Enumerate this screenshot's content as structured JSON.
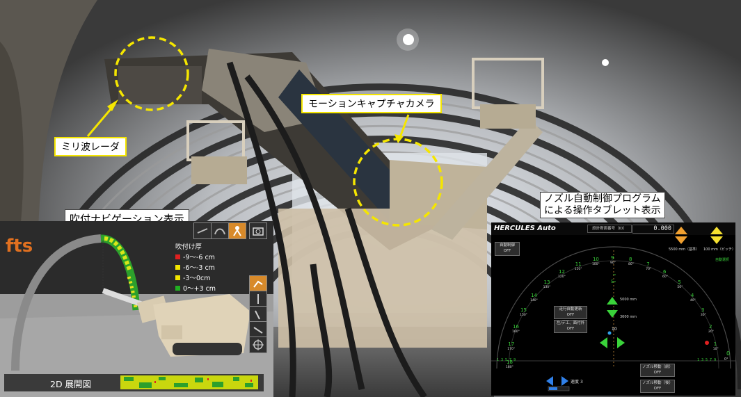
{
  "labels": {
    "radar": "ミリ波レーダ",
    "mocap": "モーションキャプチャカメラ",
    "nav_title": "吹付ナビゲーション表示",
    "tablet_title_line1": "ノズル自動制御プログラム",
    "tablet_title_line2": "による操作タブレット表示"
  },
  "nav": {
    "logo": "fts",
    "legend_title": "吹付け厚",
    "legend": [
      {
        "label": "-9〜-6 cm",
        "color": "#e02020"
      },
      {
        "label": "-6〜-3 cm",
        "color": "#f2e600"
      },
      {
        "label": "-3〜0cm",
        "color": "#f2e600"
      },
      {
        "label": "0〜+3 cm",
        "color": "#22b022"
      }
    ],
    "bottom_label": "2D 展開図",
    "tools": [
      "view-icon-1",
      "view-icon-2",
      "person-icon",
      "camera-icon"
    ],
    "side_tools": [
      "spray-icon",
      "nozzle-icon-1",
      "nozzle-icon-2",
      "nozzle-icon-3",
      "target-icon"
    ]
  },
  "tablet": {
    "brand": "HERCULES  Auto",
    "field_label": "設計断面番号（ID）",
    "field_value": "0.000",
    "auto_btn": "自動制御",
    "auto_btn_state": "OFF",
    "arrow_left_label": "5500 mm（基準）",
    "arrow_right_label": "100 mm（ピッチ）",
    "right_status": "自動選択",
    "center_vals": {
      "upper": "5000 mm",
      "lower": "3600 mm",
      "top_num": "5"
    },
    "buttons_mid": [
      {
        "label": "走行自動更新",
        "state": "OFF"
      },
      {
        "label": "左/デ工、面付外",
        "state": "OFF"
      }
    ],
    "buttons_bottom": [
      {
        "label": "ノズル移動（前）",
        "state": "OFF"
      },
      {
        "label": "ノズル移動（後）",
        "state": "OFF"
      }
    ],
    "speed_label": "速度",
    "speed_value": "3",
    "marker": "10",
    "left_scale": "1 3 5 7 9",
    "right_scale": "1 3 5 7 9",
    "sector_numbers": [
      {
        "n": "1",
        "deg": "10°"
      },
      {
        "n": "2",
        "deg": "20°"
      },
      {
        "n": "3",
        "deg": "30°"
      },
      {
        "n": "4",
        "deg": "40°"
      },
      {
        "n": "5",
        "deg": "50°"
      },
      {
        "n": "6",
        "deg": "60°"
      },
      {
        "n": "7",
        "deg": "70°"
      },
      {
        "n": "8",
        "deg": "80°"
      },
      {
        "n": "9",
        "deg": "90°"
      },
      {
        "n": "10",
        "deg": "100°"
      },
      {
        "n": "11",
        "deg": "110°"
      },
      {
        "n": "12",
        "deg": "120°"
      },
      {
        "n": "13",
        "deg": "130°"
      },
      {
        "n": "14",
        "deg": "140°"
      },
      {
        "n": "15",
        "deg": "150°"
      },
      {
        "n": "16",
        "deg": "160°"
      },
      {
        "n": "17",
        "deg": "170°"
      },
      {
        "n": "18",
        "deg": "180°"
      }
    ],
    "zero": "0",
    "zero_deg": "0°"
  },
  "colors": {
    "callout_yellow": "#f5e600",
    "tablet_green": "#3ad23a",
    "tablet_orange": "#f0a030",
    "tablet_yellow": "#f5e030",
    "tablet_blue": "#3080e8"
  }
}
